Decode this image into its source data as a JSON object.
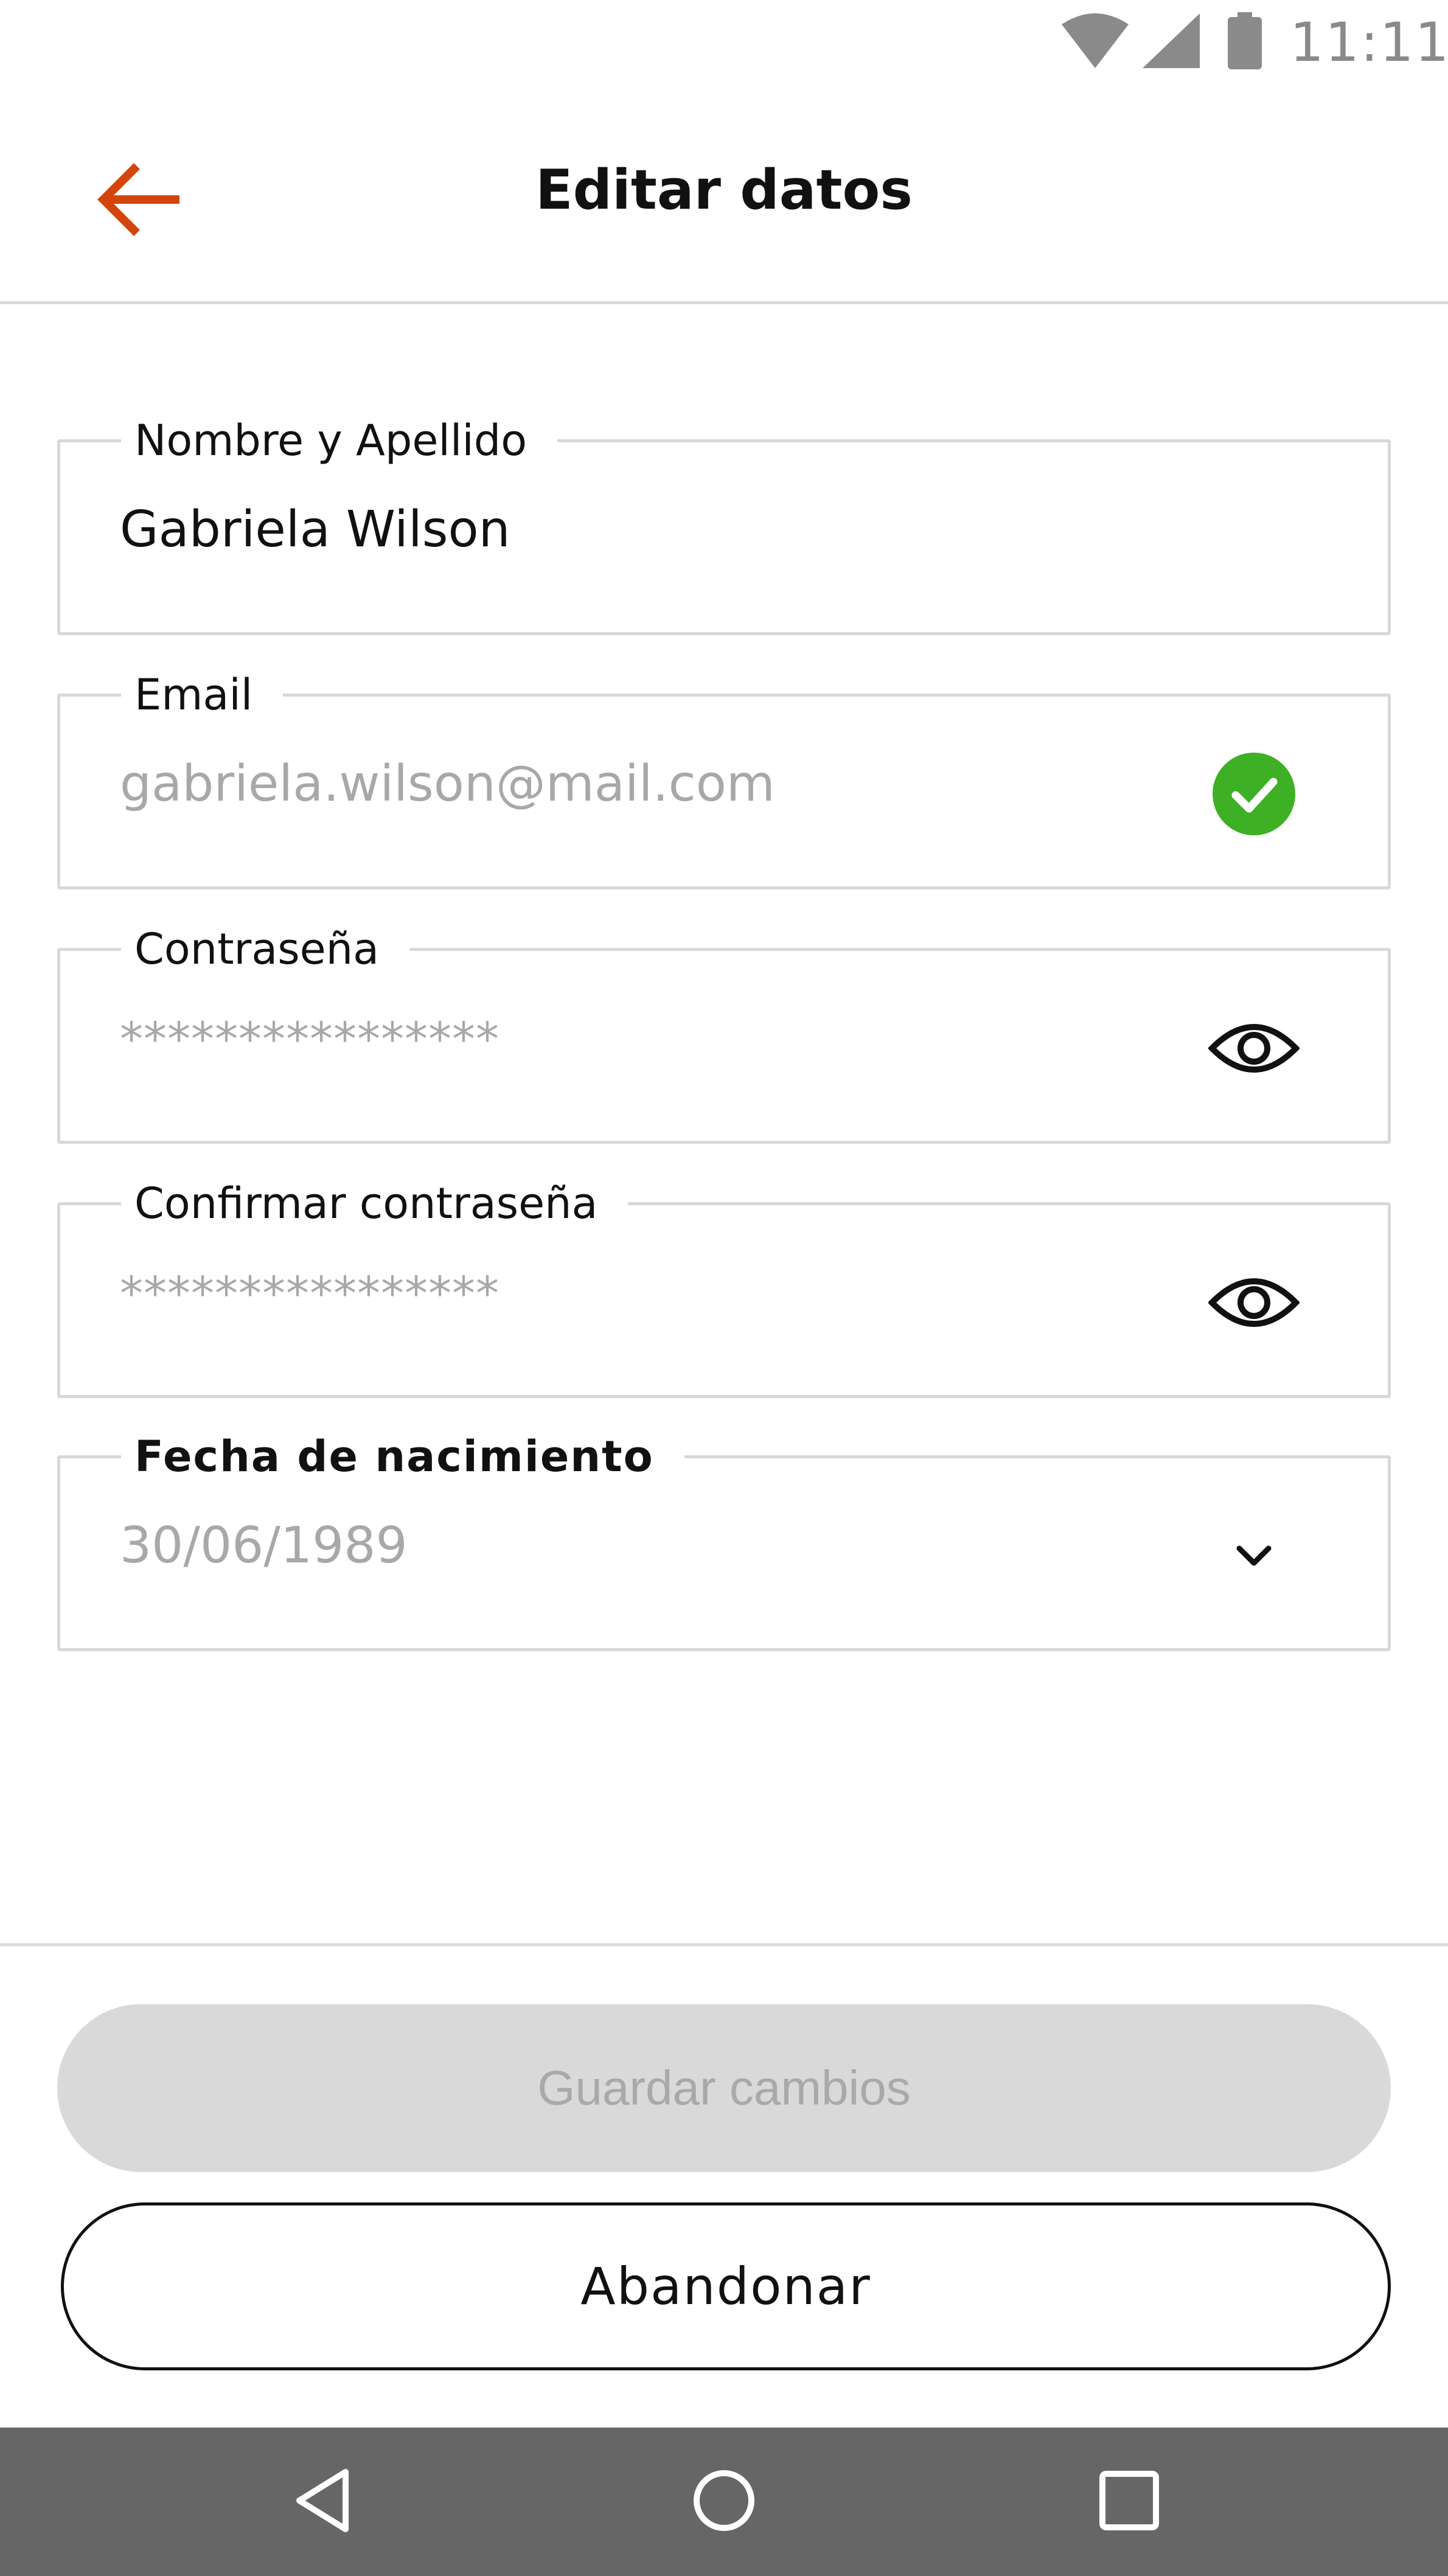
{
  "status_bar": {
    "time": "11:11",
    "icons": [
      "wifi-icon",
      "signal-icon",
      "battery-icon"
    ]
  },
  "header": {
    "title": "Editar datos",
    "back_icon": "arrow-left-icon"
  },
  "form": {
    "name": {
      "label": "Nombre y Apellido",
      "value": "Gabriela Wilson"
    },
    "email": {
      "label": "Email",
      "value": "gabriela.wilson@mail.com",
      "status_icon": "check-circle-icon"
    },
    "password": {
      "label": "Contraseña",
      "value": "****************",
      "toggle_icon": "eye-icon"
    },
    "confirm_password": {
      "label": "Confirmar contraseña",
      "value": "****************",
      "toggle_icon": "eye-icon"
    },
    "birth_date": {
      "label": "Fecha de nacimiento",
      "value": "30/06/1989",
      "dropdown_icon": "chevron-down-icon"
    }
  },
  "actions": {
    "save_label": "Guardar cambios",
    "cancel_label": "Abandonar"
  },
  "nav": {
    "icons": [
      "nav-back-icon",
      "nav-home-icon",
      "nav-recent-icon"
    ]
  },
  "colors": {
    "accent": "#D4450C",
    "success": "#3DB026",
    "disabled_bg": "#D9D9D9",
    "disabled_text": "#A9A9A9",
    "nav_bar": "#666666"
  }
}
